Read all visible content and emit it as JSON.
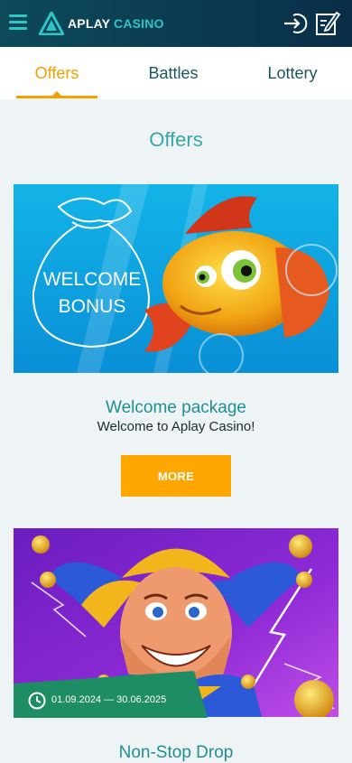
{
  "header": {
    "logo_primary": "APLAY",
    "logo_secondary": "CASINO",
    "icons": [
      "menu-icon",
      "login-icon",
      "register-icon"
    ]
  },
  "tabs": [
    {
      "label": "Offers",
      "active": true
    },
    {
      "label": "Battles",
      "active": false
    },
    {
      "label": "Lottery",
      "active": false
    }
  ],
  "page_title": "Offers",
  "offers": [
    {
      "title": "Welcome package",
      "subtitle": "Welcome to Aplay Casino!",
      "button": "MORE",
      "banner_text": "WELCOME BONUS"
    },
    {
      "title": "Non-Stop Drop",
      "date_range": "01.09.2024 — 30.06.2025"
    }
  ],
  "colors": {
    "accent": "#f5a000",
    "teal": "#3aa6a0",
    "header_bg": "#0b3a52",
    "button": "#ffa600"
  }
}
